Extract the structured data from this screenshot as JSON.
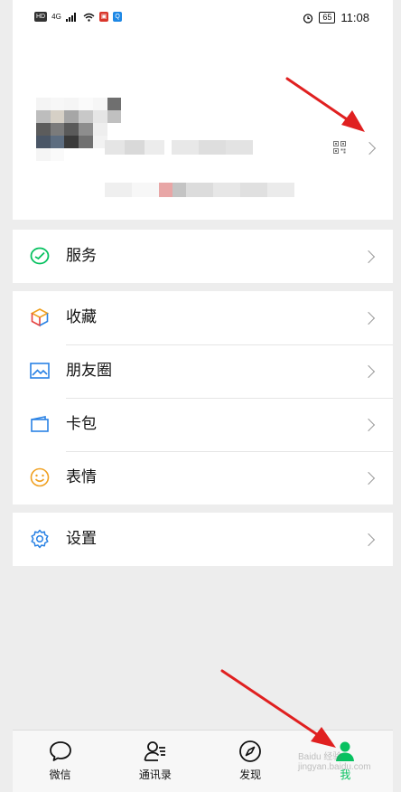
{
  "status_bar": {
    "hd": "HD",
    "network": "4G",
    "signal_badge": "Q",
    "battery": "65",
    "time": "11:08"
  },
  "menu": {
    "services": "服务",
    "favorites": "收藏",
    "moments": "朋友圈",
    "cards": "卡包",
    "stickers": "表情",
    "settings": "设置"
  },
  "tabs": [
    {
      "label": "微信"
    },
    {
      "label": "通讯录"
    },
    {
      "label": "发现"
    },
    {
      "label": "我"
    }
  ],
  "colors": {
    "accent": "#07c160",
    "arrow": "#e02020",
    "chevron": "#9a9a9a"
  },
  "watermark": "Baidu 经验  jingyan.baidu.com"
}
